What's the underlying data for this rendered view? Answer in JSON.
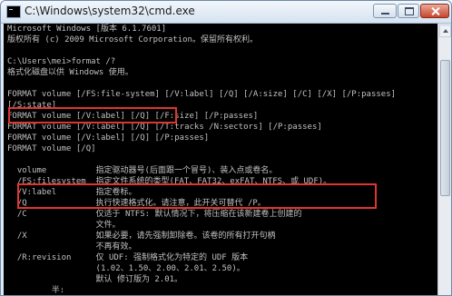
{
  "window": {
    "title": "C:\\Windows\\system32\\cmd.exe"
  },
  "console": {
    "lines": [
      "Microsoft Windows [版本 6.1.7601]",
      "版权所有 (c) 2009 Microsoft Corporation。保留所有权利。",
      "",
      "C:\\Users\\mei>format /?",
      "格式化磁盘以供 Windows 使用。",
      "",
      "FORMAT volume [/FS:file-system] [/V:label] [/Q] [/A:size] [/C] [/X] [/P:passes]",
      "[/S:state]",
      "FORMAT volume [/V:label] [/Q] [/F:size] [/P:passes]",
      "FORMAT volume [/V:label] [/Q] [/T:tracks /N:sectors] [/P:passes]",
      "FORMAT volume [/V:label] [/Q] [/P:passes]",
      "FORMAT volume [/Q]",
      "",
      "  volume          指定驱动器号(后面跟一个冒号)、装入点或卷名。",
      "  /FS:filesystem  指定文件系统的类型(FAT、FAT32、exFAT、NTFS、或 UDF)。",
      "  /V:label        指定卷标。",
      "  /Q              执行快速格式化。请注意，此开关可替代 /P。",
      "  /C              仅适于 NTFS: 默认情况下，将压缩在该新建卷上创建的",
      "                  文件。",
      "  /X              如果必要，请先强制卸除卷。该卷的所有打开句柄",
      "                  不再有效。",
      "  /R:revision     仅 UDF: 强制格式化为特定的 UDF 版本",
      "                  (1.02、1.50、2.00、2.01、2.50)。",
      "                  默认 修订版为 2.01。",
      "         半:"
    ]
  },
  "colors": {
    "console_bg": "#000000",
    "console_text": "#c0c0c0",
    "highlight": "#e0352e"
  },
  "icons": {
    "app": "cmd-icon",
    "minimize": "minimize-icon",
    "maximize": "maximize-icon",
    "close": "close-icon"
  }
}
